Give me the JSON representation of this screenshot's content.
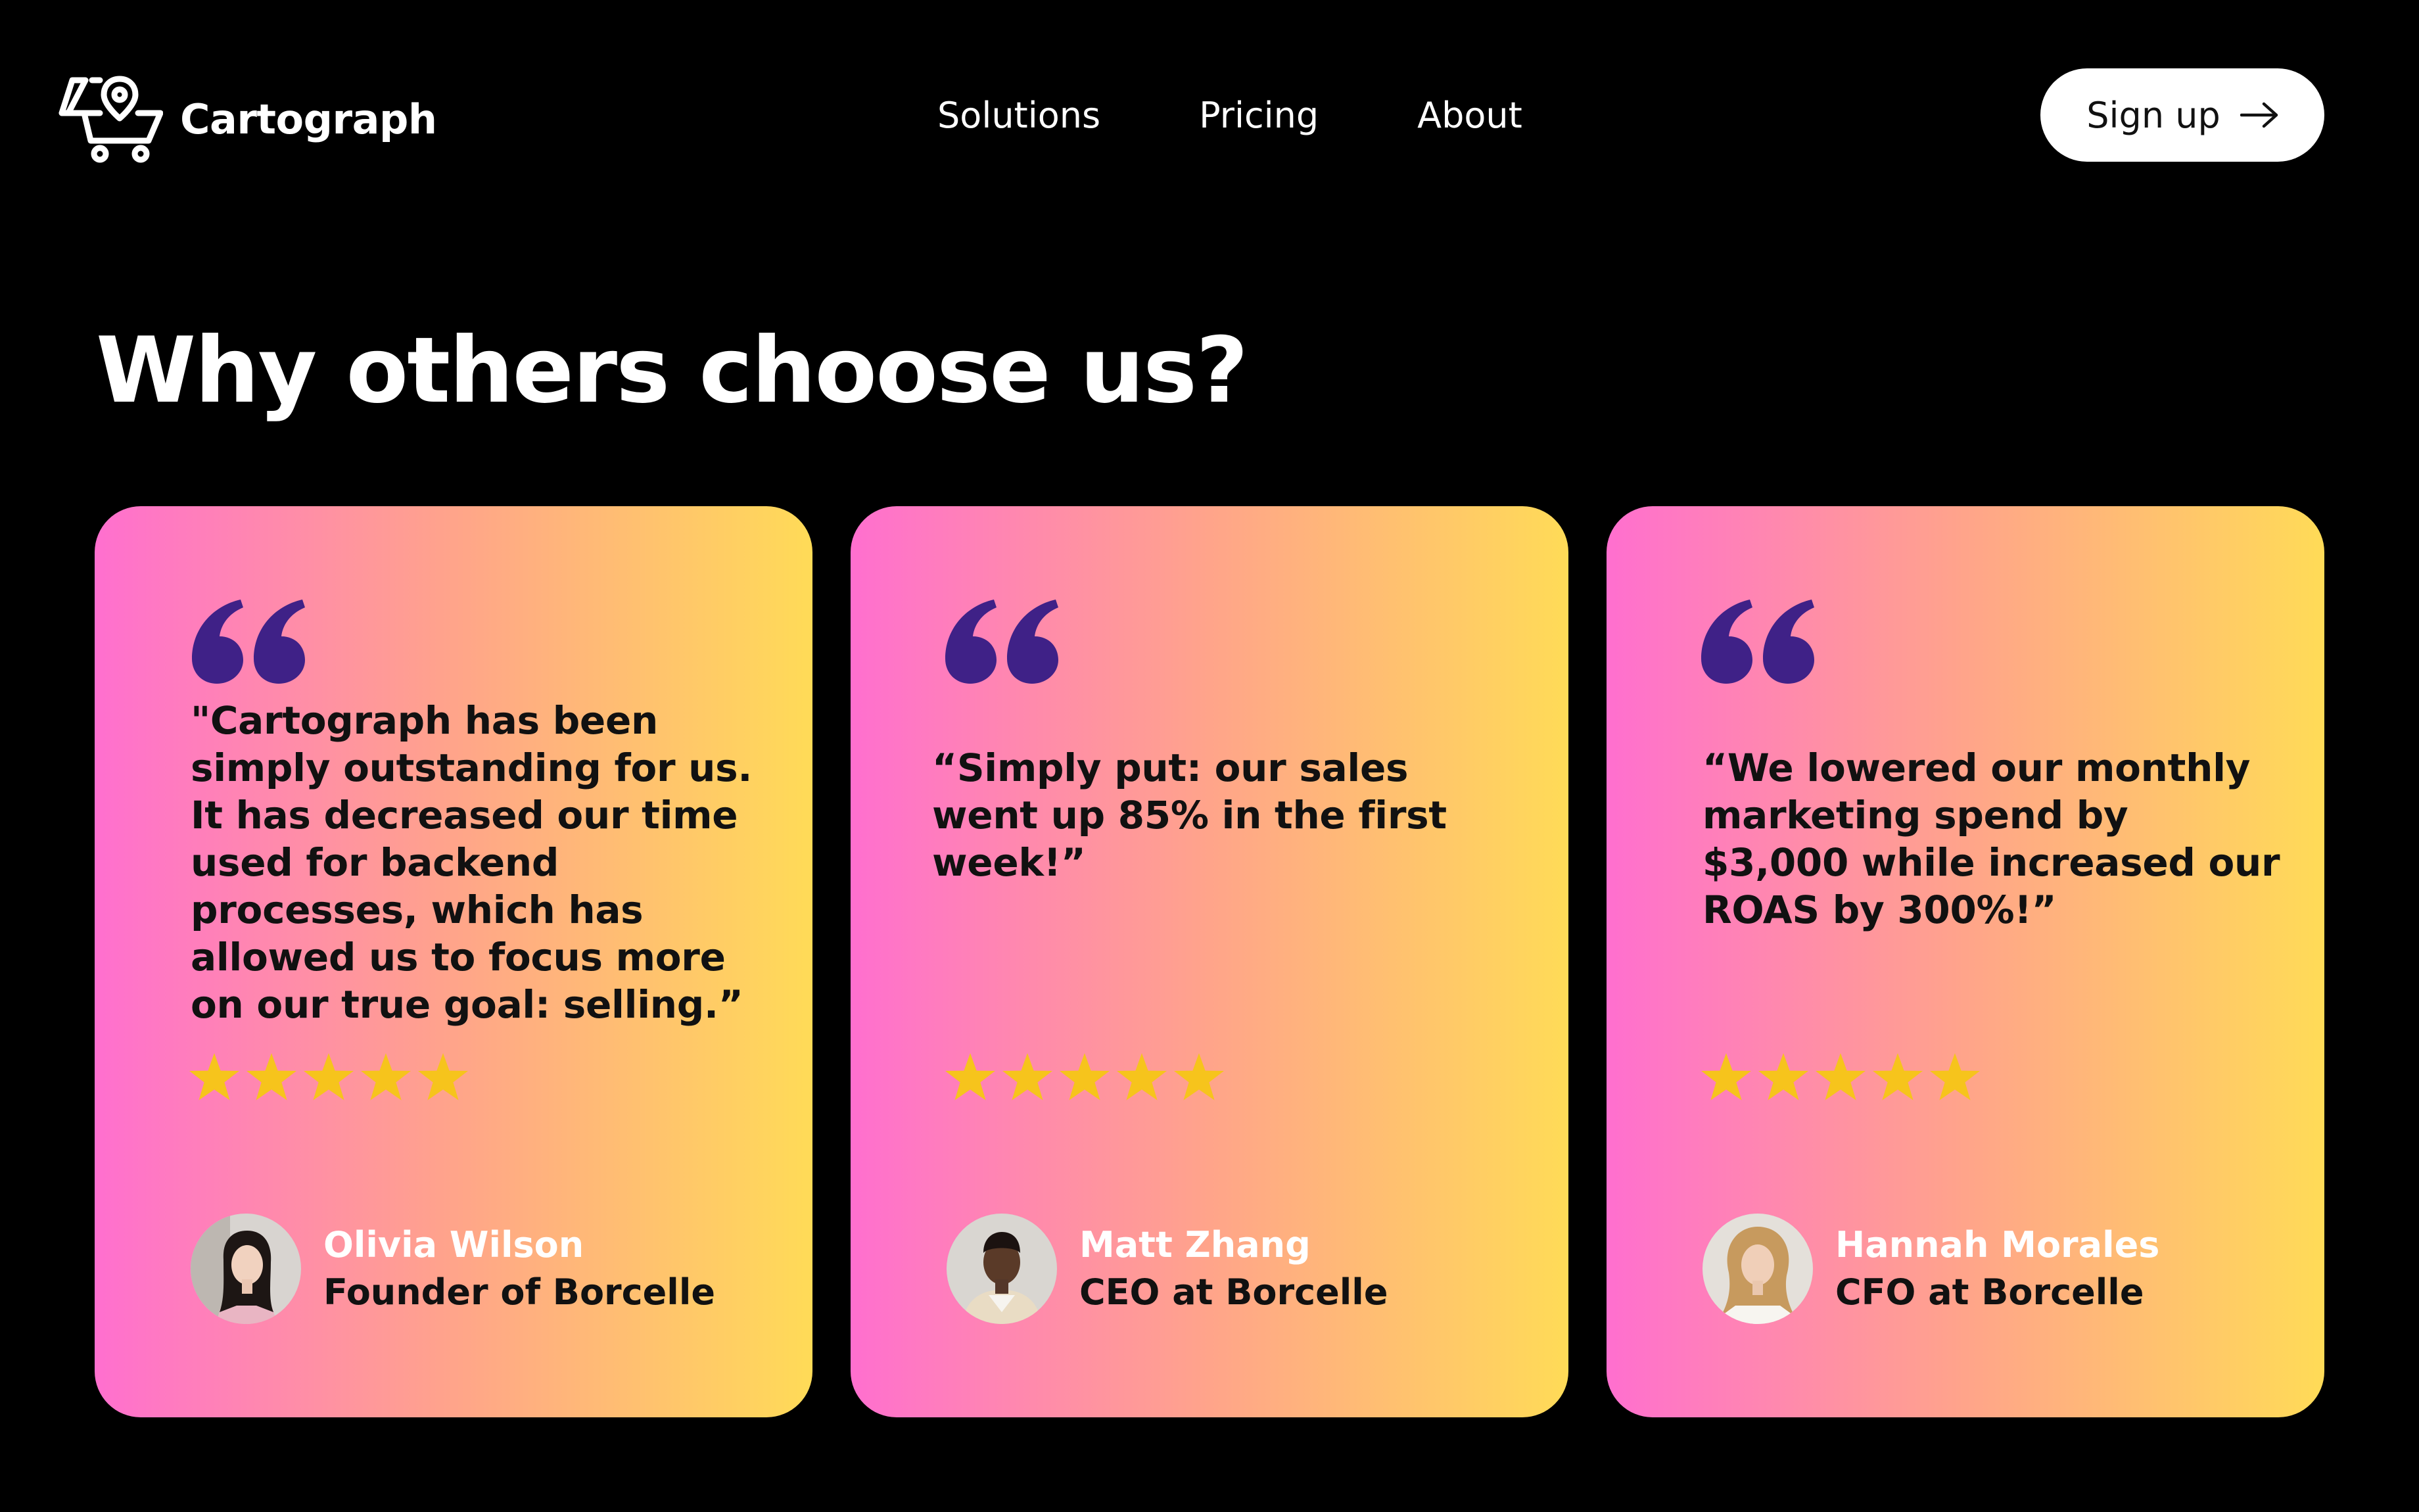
{
  "header": {
    "brand": "Cartograph",
    "nav": [
      {
        "label": "Solutions"
      },
      {
        "label": "Pricing"
      },
      {
        "label": "About"
      }
    ],
    "signup_label": "Sign up"
  },
  "main": {
    "title": "Why others choose us?",
    "testimonials": [
      {
        "quote": "\"Cartograph has been simply outstanding for us. It has decreased our time used for backend processes, which has allowed us to focus more on our true goal: selling.”",
        "rating": 5,
        "rating_max": 5,
        "name": "Olivia Wilson",
        "role": "Founder of Borcelle"
      },
      {
        "quote": "“Simply put: our sales went up 85% in the first week!”",
        "rating": 5,
        "rating_max": 5,
        "name": "Matt Zhang",
        "role": "CEO at Borcelle"
      },
      {
        "quote": "“We lowered our monthly marketing spend by $3,000 while increased our ROAS by 300%!”",
        "rating": 5,
        "rating_max": 5,
        "name": "Hannah Morales",
        "role": "CFO at Borcelle"
      }
    ]
  },
  "colors": {
    "background": "#000000",
    "gradient_start": "#ff6fcf",
    "gradient_mid": "#ffa48a",
    "gradient_end": "#ffdb57",
    "quote_icon": "#3f2187",
    "star": "#f6c41c",
    "text_dark": "#111111",
    "text_light": "#ffffff"
  },
  "icons": {
    "logo": "map-pin-cart-icon",
    "signup": "arrow-right-icon",
    "quote": "quote-mark-icon",
    "star": "star-icon"
  }
}
